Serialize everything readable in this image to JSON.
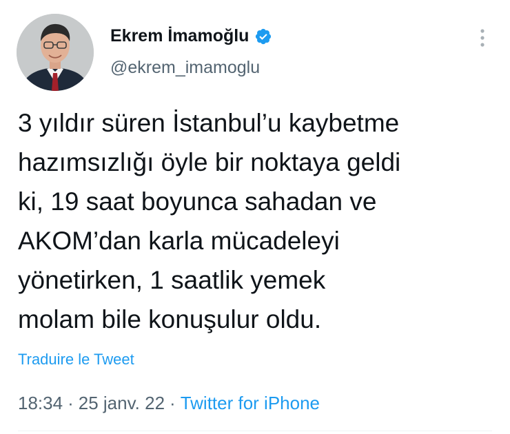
{
  "author": {
    "display_name": "Ekrem İmamoğlu",
    "handle": "@ekrem_imamoglu",
    "verified_icon": "verified-badge-icon"
  },
  "tweet": {
    "lines": [
      "3 yıldır süren İstanbul’u kaybetme",
      "hazımsızlığı öyle bir noktaya geldi",
      "ki, 19 saat boyunca sahadan ve",
      "AKOM’dan karla mücadeleyi",
      "yönetirken, 1 saatlik yemek",
      "molam bile konuşulur oldu."
    ],
    "translate_label": "Traduire le Tweet"
  },
  "meta": {
    "time": "18:34",
    "separator": "·",
    "date": "25 janv. 22",
    "source": "Twitter for iPhone"
  },
  "colors": {
    "link": "#1d9bf0",
    "secondary_text": "#536471",
    "primary_text": "#0f1419"
  }
}
